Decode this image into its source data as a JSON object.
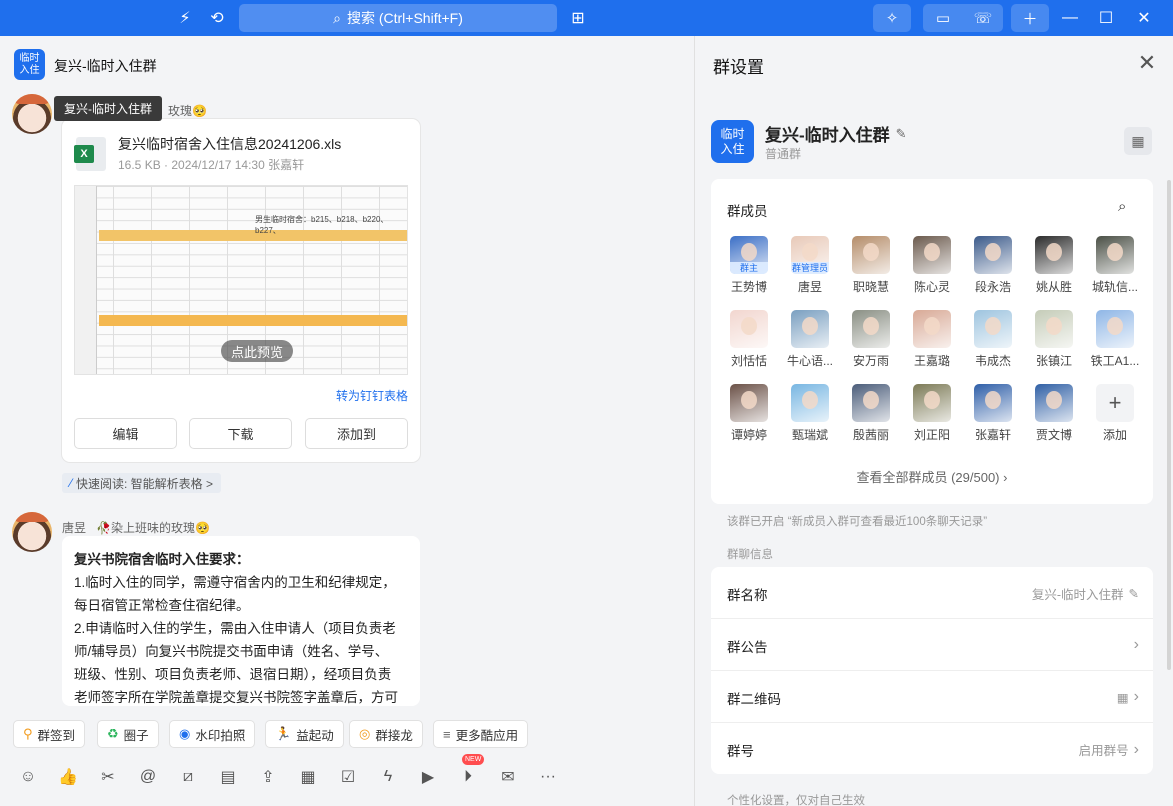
{
  "topbar": {
    "search_placeholder": "搜索 (Ctrl+Shift+F)"
  },
  "chat": {
    "title": "复兴-临时入住群",
    "avatar_text": "临时\n入住",
    "tooltip": "复兴-临时入住群",
    "first_sender_suffix": "玫瑰🥺",
    "file": {
      "name": "复兴临时宿舍入住信息20241206.xls",
      "meta": "16.5 KB · 2024/12/17 14:30 张嘉轩",
      "preview_label": "点此预览",
      "preview_caption": "男生临时宿舍：b215、b218、b220、b227、",
      "pin_table": "转为钉钉表格",
      "buttons": [
        "编辑",
        "下载",
        "添加到"
      ]
    },
    "quick_read": "快速阅读: 智能解析表格 >",
    "second_sender": "唐昱",
    "second_sender_tag": "🥀染上班味的玫瑰🥺",
    "message": {
      "title": "复兴书院宿舍临时入住要求：",
      "lines": [
        "1.临时入住的同学，需遵守宿舍内的卫生和纪律规定，",
        "每日宿管正常检查住宿纪律。",
        "2.申请临时入住的学生，需由入住申请人（项目负责老",
        "师/辅导员）向复兴书院提交书面申请（姓名、学号、",
        "班级、性别、项目负责老师、退宿日期），经项目负责",
        "老师签字所在学院盖章提交复兴书院签字盖章后，方可"
      ]
    },
    "apps": [
      "群签到",
      "圈子",
      "水印拍照",
      "益起动",
      "群接龙",
      "更多酷应用"
    ],
    "new_badge": "NEW"
  },
  "panel": {
    "title": "群设置",
    "group_name": "复兴-临时入住群",
    "group_type": "普通群",
    "avatar_text": "临时\n入住",
    "members_title": "群成员",
    "members": [
      {
        "name": "王势博",
        "role": "群主",
        "color": "#3b6fc6"
      },
      {
        "name": "唐昱",
        "role": "群管理员",
        "color": "#e8c9b8"
      },
      {
        "name": "职晓慧",
        "role": "",
        "color": "#b58d6a"
      },
      {
        "name": "陈心灵",
        "role": "",
        "color": "#6b5a4d"
      },
      {
        "name": "段永浩",
        "role": "",
        "color": "#3b5a8a"
      },
      {
        "name": "姚从胜",
        "role": "",
        "color": "#2b2b2b"
      },
      {
        "name": "城轨信...",
        "role": "",
        "color": "#4a4f45"
      },
      {
        "name": "刘恬恬",
        "role": "",
        "color": "#f2d6cf"
      },
      {
        "name": "牛心语...",
        "role": "",
        "color": "#7a9fc0"
      },
      {
        "name": "安万雨",
        "role": "",
        "color": "#8a8f84"
      },
      {
        "name": "王嘉璐",
        "role": "",
        "color": "#d8a996"
      },
      {
        "name": "韦成杰",
        "role": "",
        "color": "#9ec4df"
      },
      {
        "name": "张镇江",
        "role": "",
        "color": "#c5ccb8"
      },
      {
        "name": "铁工A1...",
        "role": "",
        "color": "#8fb6e6"
      },
      {
        "name": "谭婷婷",
        "role": "",
        "color": "#6b5147"
      },
      {
        "name": "甄瑞斌",
        "role": "",
        "color": "#78b6e2"
      },
      {
        "name": "殷茜丽",
        "role": "",
        "color": "#4b5d7a"
      },
      {
        "name": "刘正阳",
        "role": "",
        "color": "#7c7a56"
      },
      {
        "name": "张嘉轩",
        "role": "",
        "color": "#2f5fa8"
      },
      {
        "name": "贾文博",
        "role": "",
        "color": "#3060a5"
      }
    ],
    "add_label": "添加",
    "view_all": "查看全部群成员 (29/500)",
    "hint": "该群已开启 “新成员入群可查看最近100条聊天记录”",
    "info_section": "群聊信息",
    "info_rows": [
      {
        "label": "群名称",
        "value": "复兴-临时入住群"
      },
      {
        "label": "群公告",
        "value": ""
      },
      {
        "label": "群二维码",
        "value": ""
      },
      {
        "label": "群号",
        "value": "启用群号"
      }
    ],
    "personal_section": "个性化设置，仅对自己生效"
  }
}
